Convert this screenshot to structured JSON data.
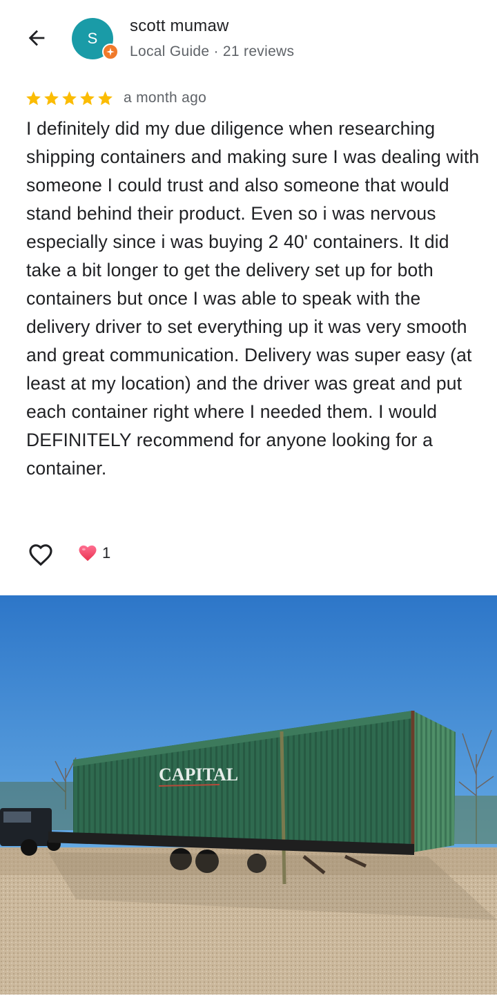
{
  "header": {
    "back_icon": "arrow-back-icon",
    "author_initial": "S",
    "author_name": "scott mumaw",
    "author_meta": "Local Guide · 21 reviews",
    "avatar_color": "#1a9ba7",
    "badge_color": "#f07a2b"
  },
  "review": {
    "rating": 5,
    "rating_max": 5,
    "time": "a month ago",
    "text": "I definitely did my due diligence when researching shipping containers and making sure I was dealing with someone I could trust and also someone that would stand behind their product. Even so i was nervous especially since i was buying 2 40' containers. It did take a bit longer to get the delivery set up for both containers but once I was able to speak with the delivery driver to set everything up it was very smooth and great communication. Delivery was super easy (at least at my location) and the driver was great and put each container right where I needed them. I would DEFINITELY recommend for anyone looking for a container."
  },
  "actions": {
    "like_icon": "heart-outline-icon",
    "reaction_icon": "heart-filled-icon",
    "reaction_count": "1"
  },
  "photo": {
    "container_brand": "CAPITAL",
    "description_icon": "review-photo"
  },
  "colors": {
    "star": "#fbbc04",
    "text_secondary": "#5f6368",
    "reaction_heart": "#f0506e"
  }
}
